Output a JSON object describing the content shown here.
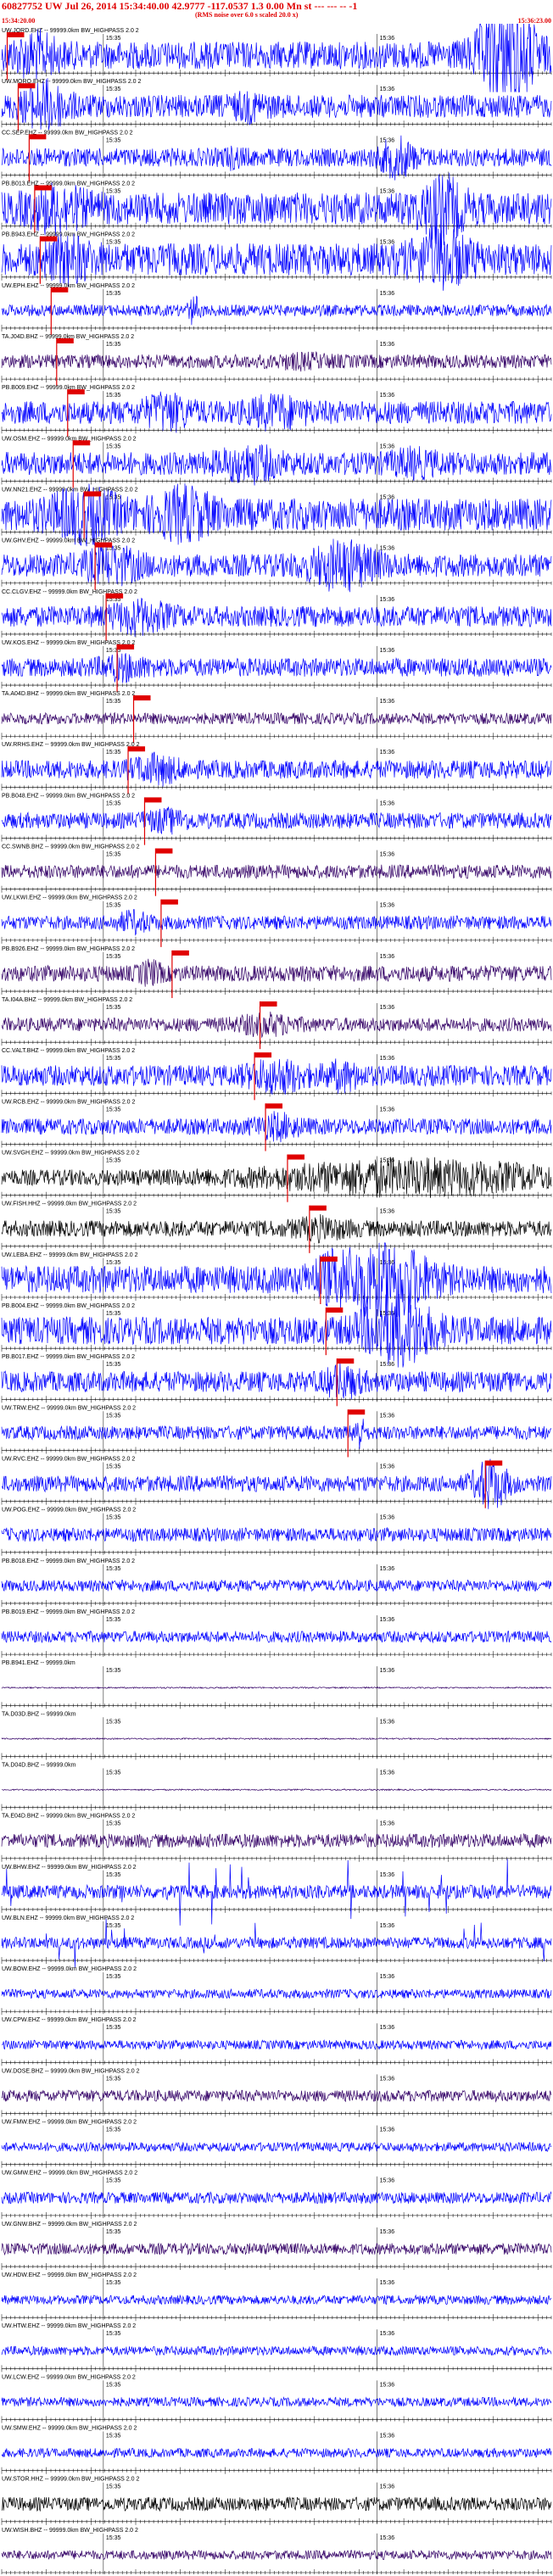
{
  "header": {
    "title": "60827752 UW Jul 26, 2014 15:34:40.00   42.9777 -117.0537  1.3 0.00 Mn st --- --- --   -1",
    "note": "(RMS noise over 6.0 s scaled 20.0 x)",
    "start_time": "15:34:20.00",
    "end_time": "15:36:23.00"
  },
  "minute_label": "15:35",
  "minute_label_2": "15:36",
  "colors": {
    "blue": "#0000ff",
    "purple": "#330066",
    "black": "#000000",
    "pick": "#e00000",
    "axis": "#000000"
  },
  "traces": [
    {
      "label": "UW.JORD.EHZ -- 99999.0km BW_HIGHPASS  2.0  2",
      "color": "blue",
      "amp": 0.6,
      "pick": 0.01,
      "burst": [
        {
          "at": 0.92,
          "w": 0.05,
          "g": 4.5
        },
        {
          "at": 0.06,
          "w": 0.04,
          "g": 2
        }
      ]
    },
    {
      "label": "UW.MORO.EHZ -- 99999.0km BW_HIGHPASS  2.0  2",
      "color": "blue",
      "amp": 0.5,
      "pick": 0.03,
      "burst": [
        {
          "at": 0.08,
          "w": 0.04,
          "g": 2.5
        },
        {
          "at": 0.45,
          "w": 0.03,
          "g": 1.6
        }
      ]
    },
    {
      "label": "CC.SEP.EHZ -- 99999.0km BW_HIGHPASS  2.0  2",
      "color": "blue",
      "amp": 0.4,
      "pick": 0.05,
      "burst": [
        {
          "at": 0.72,
          "w": 0.03,
          "g": 2.6
        },
        {
          "at": 0.42,
          "w": 0.02,
          "g": 1.5
        }
      ]
    },
    {
      "label": "PB.B013.EHZ -- 99999.0km BW_HIGHPASS  2.0  2",
      "color": "blue",
      "amp": 0.7,
      "pick": 0.06,
      "burst": [
        {
          "at": 0.8,
          "w": 0.04,
          "g": 2.4
        },
        {
          "at": 0.1,
          "w": 0.05,
          "g": 1.8
        }
      ]
    },
    {
      "label": "PB.B943.EHZ -- 99999.0km BW_HIGHPASS  2.0  2",
      "color": "blue",
      "amp": 0.7,
      "pick": 0.07,
      "burst": [
        {
          "at": 0.8,
          "w": 0.05,
          "g": 2.2
        },
        {
          "at": 0.12,
          "w": 0.04,
          "g": 1.8
        }
      ]
    },
    {
      "label": "UW.EPH.EHZ -- 99999.0km BW_HIGHPASS  2.0  2",
      "color": "blue",
      "amp": 0.25,
      "pick": 0.09,
      "burst": [
        {
          "at": 0.35,
          "w": 0.01,
          "g": 3
        }
      ]
    },
    {
      "label": "TA.J04D.BHZ -- 99999.0km BW_HIGHPASS  2.0  2",
      "color": "purple",
      "amp": 0.3,
      "pick": 0.1,
      "burst": [
        {
          "at": 0.55,
          "w": 0.05,
          "g": 1.5
        }
      ]
    },
    {
      "label": "PB.B009.EHZ -- 99999.0km BW_HIGHPASS  2.0  2",
      "color": "blue",
      "amp": 0.5,
      "pick": 0.12,
      "burst": [
        {
          "at": 0.3,
          "w": 0.04,
          "g": 2
        },
        {
          "at": 0.5,
          "w": 0.05,
          "g": 1.8
        }
      ]
    },
    {
      "label": "UW.OSM.EHZ -- 99999.0km BW_HIGHPASS  2.0  2",
      "color": "blue",
      "amp": 0.5,
      "pick": 0.13,
      "burst": [
        {
          "at": 0.45,
          "w": 0.05,
          "g": 2
        },
        {
          "at": 0.75,
          "w": 0.04,
          "g": 1.6
        }
      ]
    },
    {
      "label": "UW.NN21.EHZ -- 99999.0km BW_HIGHPASS  2.0  2",
      "color": "blue",
      "amp": 0.7,
      "pick": 0.15,
      "burst": [
        {
          "at": 0.15,
          "w": 0.06,
          "g": 2
        },
        {
          "at": 0.33,
          "w": 0.05,
          "g": 2
        }
      ]
    },
    {
      "label": "UW.GHV.EHZ -- 99999.0km BW_HIGHPASS  2.0  2",
      "color": "blue",
      "amp": 0.5,
      "pick": 0.17,
      "burst": [
        {
          "at": 0.62,
          "w": 0.06,
          "g": 2.5
        },
        {
          "at": 0.2,
          "w": 0.05,
          "g": 2
        }
      ]
    },
    {
      "label": "CC.CLGV.EHZ -- 99999.0km BW_HIGHPASS  2.0  2",
      "color": "blue",
      "amp": 0.45,
      "pick": 0.19,
      "burst": [
        {
          "at": 0.25,
          "w": 0.05,
          "g": 2
        }
      ]
    },
    {
      "label": "UW.KOS.EHZ -- 99999.0km BW_HIGHPASS  2.0  2",
      "color": "blue",
      "amp": 0.4,
      "pick": 0.21,
      "burst": [
        {
          "at": 0.22,
          "w": 0.04,
          "g": 1.8
        }
      ]
    },
    {
      "label": "TA.A04D.BHZ -- 99999.0km BW_HIGHPASS  2.0  2",
      "color": "purple",
      "amp": 0.25,
      "pick": 0.24,
      "burst": []
    },
    {
      "label": "UW.RRHS.EHZ -- 99999.0km BW_HIGHPASS  2.0  2",
      "color": "blue",
      "amp": 0.4,
      "pick": 0.23,
      "burst": [
        {
          "at": 0.28,
          "w": 0.04,
          "g": 2
        }
      ]
    },
    {
      "label": "PB.B048.EHZ -- 99999.0km BW_HIGHPASS  2.0  2",
      "color": "blue",
      "amp": 0.35,
      "pick": 0.26,
      "burst": [
        {
          "at": 0.3,
          "w": 0.04,
          "g": 1.8
        }
      ]
    },
    {
      "label": "CC.SWNB.BHZ -- 99999.0km BW_HIGHPASS  2.0  2",
      "color": "purple",
      "amp": 0.3,
      "pick": 0.28,
      "burst": []
    },
    {
      "label": "UW.LKWI.EHZ -- 99999.0km BW_HIGHPASS  2.0  2",
      "color": "blue",
      "amp": 0.3,
      "pick": 0.29,
      "burst": [
        {
          "at": 0.24,
          "w": 0.03,
          "g": 2
        }
      ]
    },
    {
      "label": "PB.B926.EHZ -- 99999.0km BW_HIGHPASS  2.0  2",
      "color": "purple",
      "amp": 0.35,
      "pick": 0.31,
      "burst": [
        {
          "at": 0.27,
          "w": 0.02,
          "g": 2
        }
      ]
    },
    {
      "label": "TA.I04A.BHZ -- 99999.0km BW_HIGHPASS  2.0  2",
      "color": "purple",
      "amp": 0.3,
      "pick": 0.47,
      "burst": [
        {
          "at": 0.48,
          "w": 0.05,
          "g": 2
        }
      ]
    },
    {
      "label": "CC.VALT.BHZ -- 99999.0km BW_HIGHPASS  2.0  2",
      "color": "blue",
      "amp": 0.45,
      "pick": 0.46,
      "burst": [
        {
          "at": 0.5,
          "w": 0.05,
          "g": 2
        },
        {
          "at": 0.62,
          "w": 0.03,
          "g": 1.8
        }
      ]
    },
    {
      "label": "UW.RCB.EHZ -- 99999.0km BW_HIGHPASS  2.0  2",
      "color": "blue",
      "amp": 0.35,
      "pick": 0.48,
      "burst": [
        {
          "at": 0.5,
          "w": 0.04,
          "g": 2
        }
      ]
    },
    {
      "label": "UW.SVGH.EHZ -- 99999.0km BW_HIGHPASS  2.0  2",
      "color": "black",
      "amp": 0.35,
      "pick": 0.52,
      "burst": [
        {
          "at": 0.75,
          "w": 0.25,
          "g": 2.6
        }
      ]
    },
    {
      "label": "UW.FISH.HHZ -- 99999.0km BW_HIGHPASS  2.0  2",
      "color": "black",
      "amp": 0.35,
      "pick": 0.56,
      "burst": [
        {
          "at": 0.58,
          "w": 0.05,
          "g": 1.8
        }
      ]
    },
    {
      "label": "UW.LEBA.EHZ -- 99999.0km BW_HIGHPASS  2.0  2",
      "color": "blue",
      "amp": 0.6,
      "pick": 0.58,
      "burst": [
        {
          "at": 0.7,
          "w": 0.07,
          "g": 3.5
        },
        {
          "at": 0.6,
          "w": 0.04,
          "g": 2
        }
      ]
    },
    {
      "label": "PB.B004.EHZ -- 99999.0km BW_HIGHPASS  2.0  2",
      "color": "blue",
      "amp": 0.6,
      "pick": 0.59,
      "burst": [
        {
          "at": 0.72,
          "w": 0.06,
          "g": 3
        }
      ]
    },
    {
      "label": "PB.B017.EHZ -- 99999.0km BW_HIGHPASS  2.0  2",
      "color": "blue",
      "amp": 0.45,
      "pick": 0.61,
      "burst": [
        {
          "at": 0.62,
          "w": 0.03,
          "g": 2
        }
      ]
    },
    {
      "label": "UW.TRW.EHZ -- 99999.0km BW_HIGHPASS  2.0  2",
      "color": "blue",
      "amp": 0.3,
      "pick": 0.63,
      "burst": [
        {
          "at": 0.65,
          "w": 0.01,
          "g": 3
        }
      ]
    },
    {
      "label": "UW.RVC.EHZ -- 99999.0km BW_HIGHPASS  2.0  2",
      "color": "blue",
      "amp": 0.35,
      "pick": 0.88,
      "burst": [
        {
          "at": 0.89,
          "w": 0.03,
          "g": 3.5
        }
      ]
    },
    {
      "label": "UW.POG.EHZ -- 99999.0km BW_HIGHPASS  2.0  2",
      "color": "blue",
      "amp": 0.3,
      "pick": -1,
      "burst": []
    },
    {
      "label": "PB.B018.EHZ -- 99999.0km BW_HIGHPASS  2.0  2",
      "color": "blue",
      "amp": 0.25,
      "pick": -1,
      "burst": []
    },
    {
      "label": "PB.B019.EHZ -- 99999.0km BW_HIGHPASS  2.0  2",
      "color": "blue",
      "amp": 0.25,
      "pick": -1,
      "burst": []
    },
    {
      "label": "PB.B941.EHZ -- 99999.0km",
      "color": "purple",
      "amp": 0.03,
      "pick": -1,
      "burst": []
    },
    {
      "label": "TA.D03D.BHZ -- 99999.0km",
      "color": "purple",
      "amp": 0.03,
      "pick": -1,
      "burst": []
    },
    {
      "label": "TA.D04D.BHZ -- 99999.0km",
      "color": "purple",
      "amp": 0.03,
      "pick": -1,
      "burst": []
    },
    {
      "label": "TA.E04D.BHZ -- 99999.0km BW_HIGHPASS  2.0  2",
      "color": "purple",
      "amp": 0.3,
      "pick": -1,
      "burst": []
    },
    {
      "label": "UW.BHW.EHZ -- 99999.0km BW_HIGHPASS  2.0  2",
      "color": "blue",
      "amp": 0.3,
      "pick": -1,
      "spiky": true,
      "burst": []
    },
    {
      "label": "UW.BLN.EHZ -- 99999.0km BW_HIGHPASS  2.0  2",
      "color": "blue",
      "amp": 0.25,
      "pick": -1,
      "spiky": true,
      "burst": []
    },
    {
      "label": "UW.BOW.EHZ -- 99999.0km BW_HIGHPASS  2.0  2",
      "color": "blue",
      "amp": 0.2,
      "pick": -1,
      "burst": []
    },
    {
      "label": "UW.CPW.EHZ -- 99999.0km BW_HIGHPASS  2.0  2",
      "color": "blue",
      "amp": 0.2,
      "pick": -1,
      "burst": []
    },
    {
      "label": "UW.DOSE.BHZ -- 99999.0km BW_HIGHPASS  2.0  2",
      "color": "purple",
      "amp": 0.25,
      "pick": -1,
      "burst": []
    },
    {
      "label": "UW.FMW.EHZ -- 99999.0km BW_HIGHPASS  2.0  2",
      "color": "blue",
      "amp": 0.2,
      "pick": -1,
      "burst": []
    },
    {
      "label": "UW.GMW.EHZ -- 99999.0km BW_HIGHPASS  2.0  2",
      "color": "blue",
      "amp": 0.25,
      "pick": -1,
      "burst": []
    },
    {
      "label": "UW.GNW.BHZ -- 99999.0km BW_HIGHPASS  2.0  2",
      "color": "purple",
      "amp": 0.25,
      "pick": -1,
      "burst": []
    },
    {
      "label": "UW.HDW.EHZ -- 99999.0km BW_HIGHPASS  2.0  2",
      "color": "blue",
      "amp": 0.2,
      "pick": -1,
      "burst": []
    },
    {
      "label": "UW.HTW.EHZ -- 99999.0km BW_HIGHPASS  2.0  2",
      "color": "blue",
      "amp": 0.2,
      "pick": -1,
      "burst": []
    },
    {
      "label": "UW.LCW.EHZ -- 99999.0km BW_HIGHPASS  2.0  2",
      "color": "blue",
      "amp": 0.2,
      "pick": -1,
      "burst": []
    },
    {
      "label": "UW.SMW.EHZ -- 99999.0km BW_HIGHPASS  2.0  2",
      "color": "blue",
      "amp": 0.2,
      "pick": -1,
      "burst": []
    },
    {
      "label": "UW.STOR.HHZ -- 99999.0km BW_HIGHPASS  2.0  2",
      "color": "black",
      "amp": 0.3,
      "pick": -1,
      "burst": []
    },
    {
      "label": "UW.WISH.BHZ -- 99999.0km BW_HIGHPASS  2.0  2",
      "color": "purple",
      "amp": 0.2,
      "pick": -1,
      "burst": []
    }
  ]
}
